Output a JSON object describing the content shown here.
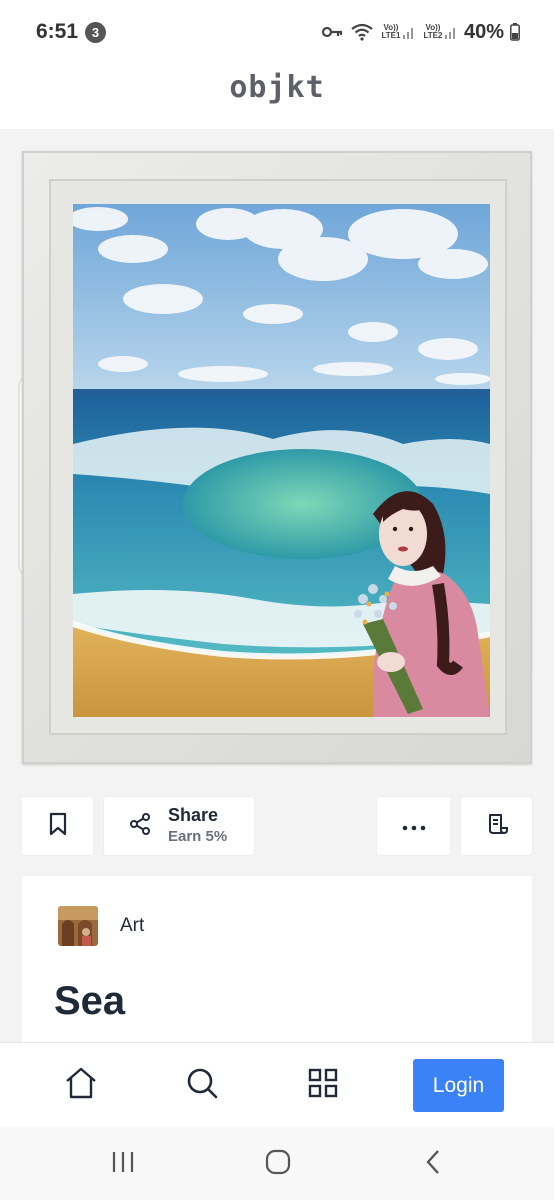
{
  "status_bar": {
    "time": "6:51",
    "notification_count": "3",
    "sim1_label": "Vo)) LTE1",
    "sim2_label": "Vo)) LTE2",
    "battery_percent": "40%",
    "icons": [
      "key-icon",
      "wifi-icon",
      "signal-icon",
      "signal-icon",
      "battery-icon"
    ]
  },
  "header": {
    "logo": "objkt"
  },
  "actions": {
    "bookmark_icon": "bookmark-icon",
    "share_label": "Share",
    "share_sub": "Earn 5%",
    "share_icon": "share-icon",
    "more_icon": "more-horizontal-icon",
    "details_icon": "document-icon"
  },
  "artwork": {
    "collection_name": "Art",
    "title": "Sea"
  },
  "bottom_nav": {
    "items": [
      {
        "icon": "home-icon"
      },
      {
        "icon": "search-icon"
      },
      {
        "icon": "grid-icon"
      }
    ],
    "login_label": "Login"
  },
  "colors": {
    "accent": "#3b82f6",
    "title": "#1e2a38",
    "logo": "#5d6068",
    "background": "#f3f3f4"
  }
}
